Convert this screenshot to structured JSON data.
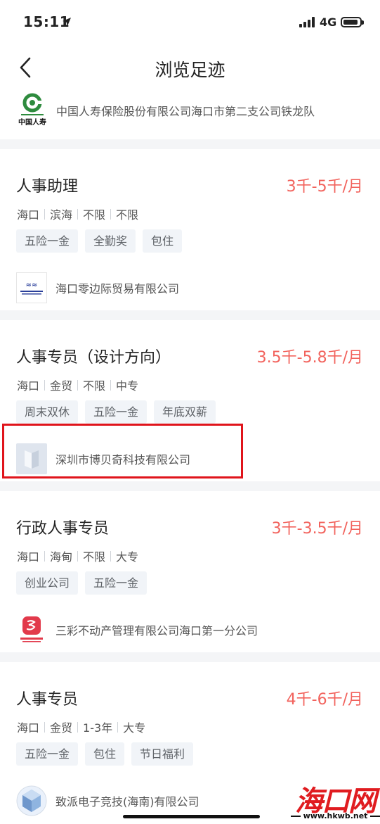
{
  "status_bar": {
    "time": "15:11",
    "network": "4G"
  },
  "nav": {
    "title": "浏览足迹"
  },
  "top_company": {
    "name": "中国人寿保险股份有限公司海口市第二支公司铁龙队",
    "logo_text": "中国人寿"
  },
  "jobs": [
    {
      "title": "人事助理",
      "salary": "3千-5千/月",
      "meta": [
        "海口",
        "滨海",
        "不限",
        "不限"
      ],
      "tags": [
        "五险一金",
        "全勤奖",
        "包住"
      ],
      "company": "海口零边际贸易有限公司"
    },
    {
      "title": "人事专员（设计方向）",
      "salary": "3.5千-5.8千/月",
      "meta": [
        "海口",
        "金贸",
        "不限",
        "中专"
      ],
      "tags": [
        "周末双休",
        "五险一金",
        "年底双薪"
      ],
      "company": "深圳市博贝奇科技有限公司"
    },
    {
      "title": "行政人事专员",
      "salary": "3千-3.5千/月",
      "meta": [
        "海口",
        "海甸",
        "不限",
        "大专"
      ],
      "tags": [
        "创业公司",
        "五险一金"
      ],
      "company": "三彩不动产管理有限公司海口第一分公司"
    },
    {
      "title": "人事专员",
      "salary": "4千-6千/月",
      "meta": [
        "海口",
        "金贸",
        "1-3年",
        "大专"
      ],
      "tags": [
        "五险一金",
        "包住",
        "节日福利"
      ],
      "company": "致派电子竞技(海南)有限公司"
    }
  ],
  "watermark": {
    "text": "海口网",
    "url": "www.hkwb.net"
  },
  "colors": {
    "salary": "#f2635d",
    "highlight": "#e0141b",
    "separator": "#f4f5f7"
  }
}
